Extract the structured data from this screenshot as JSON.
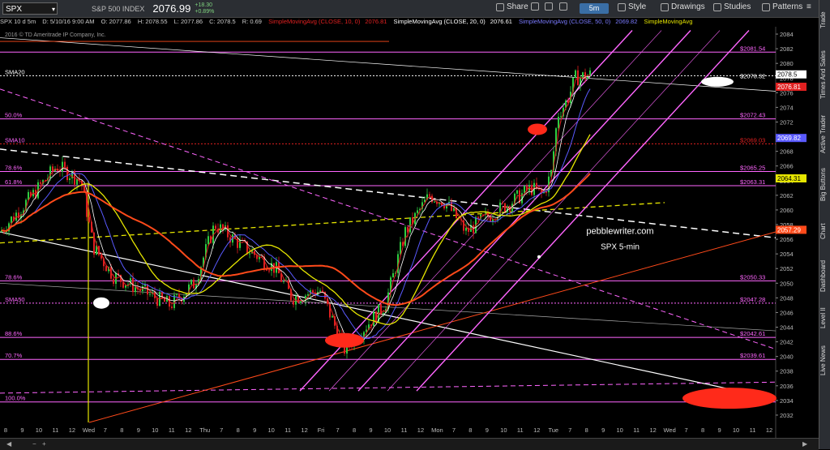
{
  "toolbar": {
    "symbol": "SPX",
    "index_name": "S&P 500 INDEX",
    "last_price": "2076.99",
    "change_abs": "+18.30",
    "change_pct": "+0.89%",
    "share": "Share",
    "style": "Style",
    "drawings": "Drawings",
    "studies": "Studies",
    "patterns": "Patterns",
    "timeframe": "5m"
  },
  "infobar": {
    "desc": "SPX 10 d 5m",
    "date": "D: 5/10/16 9:00 AM",
    "open": "O: 2077.86",
    "high": "H: 2078.55",
    "low": "L: 2077.86",
    "close": "C: 2078.5",
    "range": "R: 0.69",
    "sma10": "SimpleMovingAvg (CLOSE, 10, 0)",
    "sma10_val": "2076.81",
    "sma20": "SimpleMovingAvg (CLOSE, 20, 0)",
    "sma20_val": "2076.61",
    "sma50": "SimpleMovingAvg (CLOSE, 50, 0)",
    "sma50_val": "2069.82",
    "sma100": "SimpleMovingAvg",
    "copyright": "2016 © TD Ameritrade IP Company, Inc."
  },
  "sidebar": [
    "Trade",
    "Times And Sales",
    "Active Trader",
    "Big Buttons",
    "Chart",
    "Dashboard",
    "Level II",
    "Live News"
  ],
  "chart_data": {
    "type": "candlestick",
    "ylim": [
      2031,
      2085
    ],
    "y_ticks": [
      2032,
      2034,
      2036,
      2038,
      2040,
      2042,
      2044,
      2046,
      2048,
      2050,
      2052,
      2054,
      2056,
      2058,
      2060,
      2062,
      2064,
      2066,
      2068,
      2070,
      2072,
      2074,
      2076,
      2078,
      2080,
      2082,
      2084
    ],
    "x_labels": [
      "8",
      "9",
      "10",
      "11",
      "12",
      "Wed",
      "7",
      "8",
      "9",
      "10",
      "11",
      "12",
      "Thu",
      "7",
      "8",
      "9",
      "10",
      "11",
      "12",
      "Fri",
      "7",
      "8",
      "9",
      "10",
      "11",
      "12",
      "Mon",
      "7",
      "8",
      "9",
      "10",
      "11",
      "12",
      "Tue",
      "7",
      "8",
      "9",
      "10",
      "11",
      "12",
      "Wed",
      "7",
      "8",
      "9",
      "10",
      "11",
      "12"
    ],
    "fib_levels": [
      {
        "name": "50.0%",
        "value": 2072.43,
        "label": "$2072.43"
      },
      {
        "name": "SMA10",
        "value": 2069.03,
        "label": "$2069.03"
      },
      {
        "name": "78.6%",
        "value": 2065.25,
        "label": "$2065.25"
      },
      {
        "name": "61.8%",
        "value": 2063.31,
        "label": "$2063.31"
      },
      {
        "name": "78.6%",
        "value": 2050.33,
        "label": "$2050.33"
      },
      {
        "name": "SMA50",
        "value": 2047.28,
        "label": "$2047.28"
      },
      {
        "name": "88.6%",
        "value": 2042.61,
        "label": "$2042.61"
      },
      {
        "name": "70.7%",
        "value": 2039.61,
        "label": "$2039.61"
      },
      {
        "name": "100.0%",
        "value": 2033.8,
        "label": "$2033.8"
      }
    ],
    "top_level": {
      "value": 2081.54,
      "label": "$2081.54"
    },
    "sma20_level": {
      "name": "SMA20",
      "value": 2078.32,
      "label": "$2078.32"
    },
    "right_badges": [
      {
        "value": 2078.5,
        "label": "2078.5",
        "color": "#ffffff",
        "text": "#000"
      },
      {
        "value": 2076.81,
        "label": "2076.81",
        "color": "#e02020",
        "text": "#fff"
      },
      {
        "value": 2069.82,
        "label": "2069.82",
        "color": "#5a5aff",
        "text": "#fff"
      },
      {
        "value": 2064.31,
        "label": "2064.31",
        "color": "#e6e600",
        "text": "#000"
      },
      {
        "value": 2057.29,
        "label": "2057.29",
        "color": "#ff4a1a",
        "text": "#fff"
      }
    ],
    "watermark": [
      "pebblewriter.com",
      "SPX 5-min"
    ],
    "colors": {
      "fib": "#ff66ff",
      "sma10": "#e02020",
      "sma20": "#ffffff",
      "sma50": "#5a5aff",
      "sma100": "#e6e600",
      "sma200": "#ff4a1a",
      "channel": "#ff66ff"
    }
  }
}
